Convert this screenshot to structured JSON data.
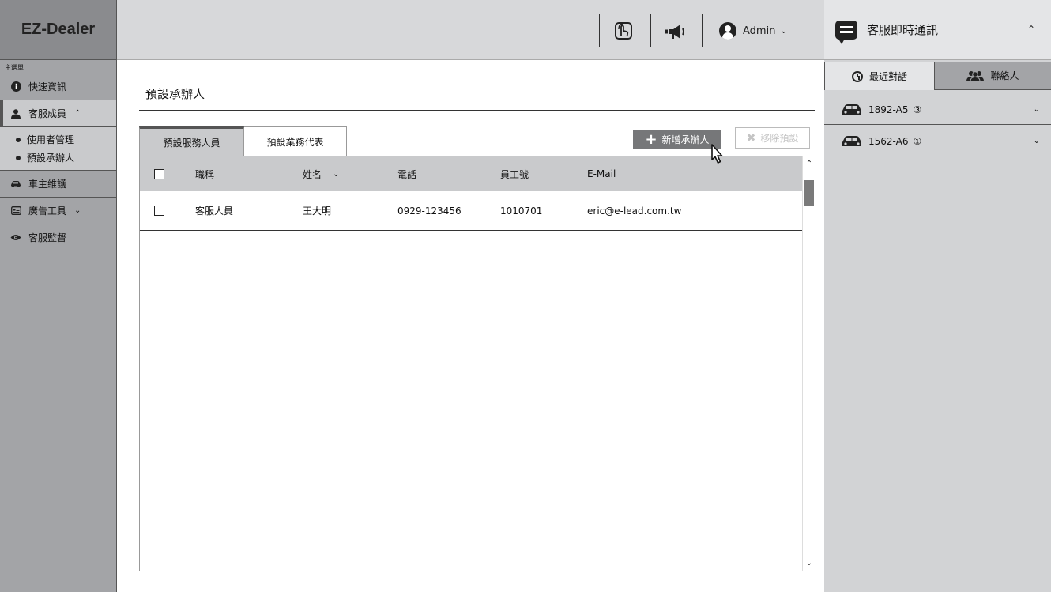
{
  "app": {
    "logo": "EZ-Dealer"
  },
  "sidebar": {
    "caption": "主選單",
    "items": [
      {
        "label": "快速資訊",
        "icon": "info-icon"
      },
      {
        "label": "客服成員",
        "icon": "user-icon",
        "expanded": true,
        "chevron": "⌃"
      },
      {
        "label": "車主維護",
        "icon": "car-icon"
      },
      {
        "label": "廣告工具",
        "icon": "newspaper-icon",
        "chevron": "⌄"
      },
      {
        "label": "客服監督",
        "icon": "eye-icon"
      }
    ],
    "subitems": [
      {
        "label": "使用者管理"
      },
      {
        "label": "預設承辦人"
      }
    ]
  },
  "topbar": {
    "icons": [
      "touch-icon",
      "megaphone-icon"
    ],
    "user": "Admin",
    "chevron": "⌄"
  },
  "main": {
    "title": "預設承辦人",
    "tabs": [
      {
        "label": "預設服務人員",
        "active": true
      },
      {
        "label": "預設業務代表",
        "active": false
      }
    ],
    "add_button": "新增承辦人",
    "remove_button": "移除預設",
    "table": {
      "columns": [
        "職稱",
        "姓名",
        "電話",
        "員工號",
        "E-Mail"
      ],
      "sort_chevron": "⌄",
      "rows": [
        {
          "title": "客服人員",
          "name": "王大明",
          "phone": "0929-123456",
          "emp_no": "1010701",
          "email": "eric@e-lead.com.tw"
        }
      ]
    },
    "scroll_up": "⌃",
    "scroll_down": "⌄"
  },
  "chat": {
    "title": "客服即時通訊",
    "chevron": "⌃",
    "tabs": [
      {
        "label": "最近對話",
        "icon": "clock-icon",
        "active": true
      },
      {
        "label": "聯絡人",
        "icon": "contacts-icon",
        "active": false
      }
    ],
    "conversations": [
      {
        "plate": "1892-A5",
        "count": "③"
      },
      {
        "plate": "1562-A6",
        "count": "①"
      }
    ],
    "conv_chevron": "⌄"
  },
  "colors": {
    "sidebar_bg": "#a3a4a7",
    "topbar_bg": "#d7d8da",
    "header_row_bg": "#c9cacc",
    "add_button_bg": "#767779"
  }
}
